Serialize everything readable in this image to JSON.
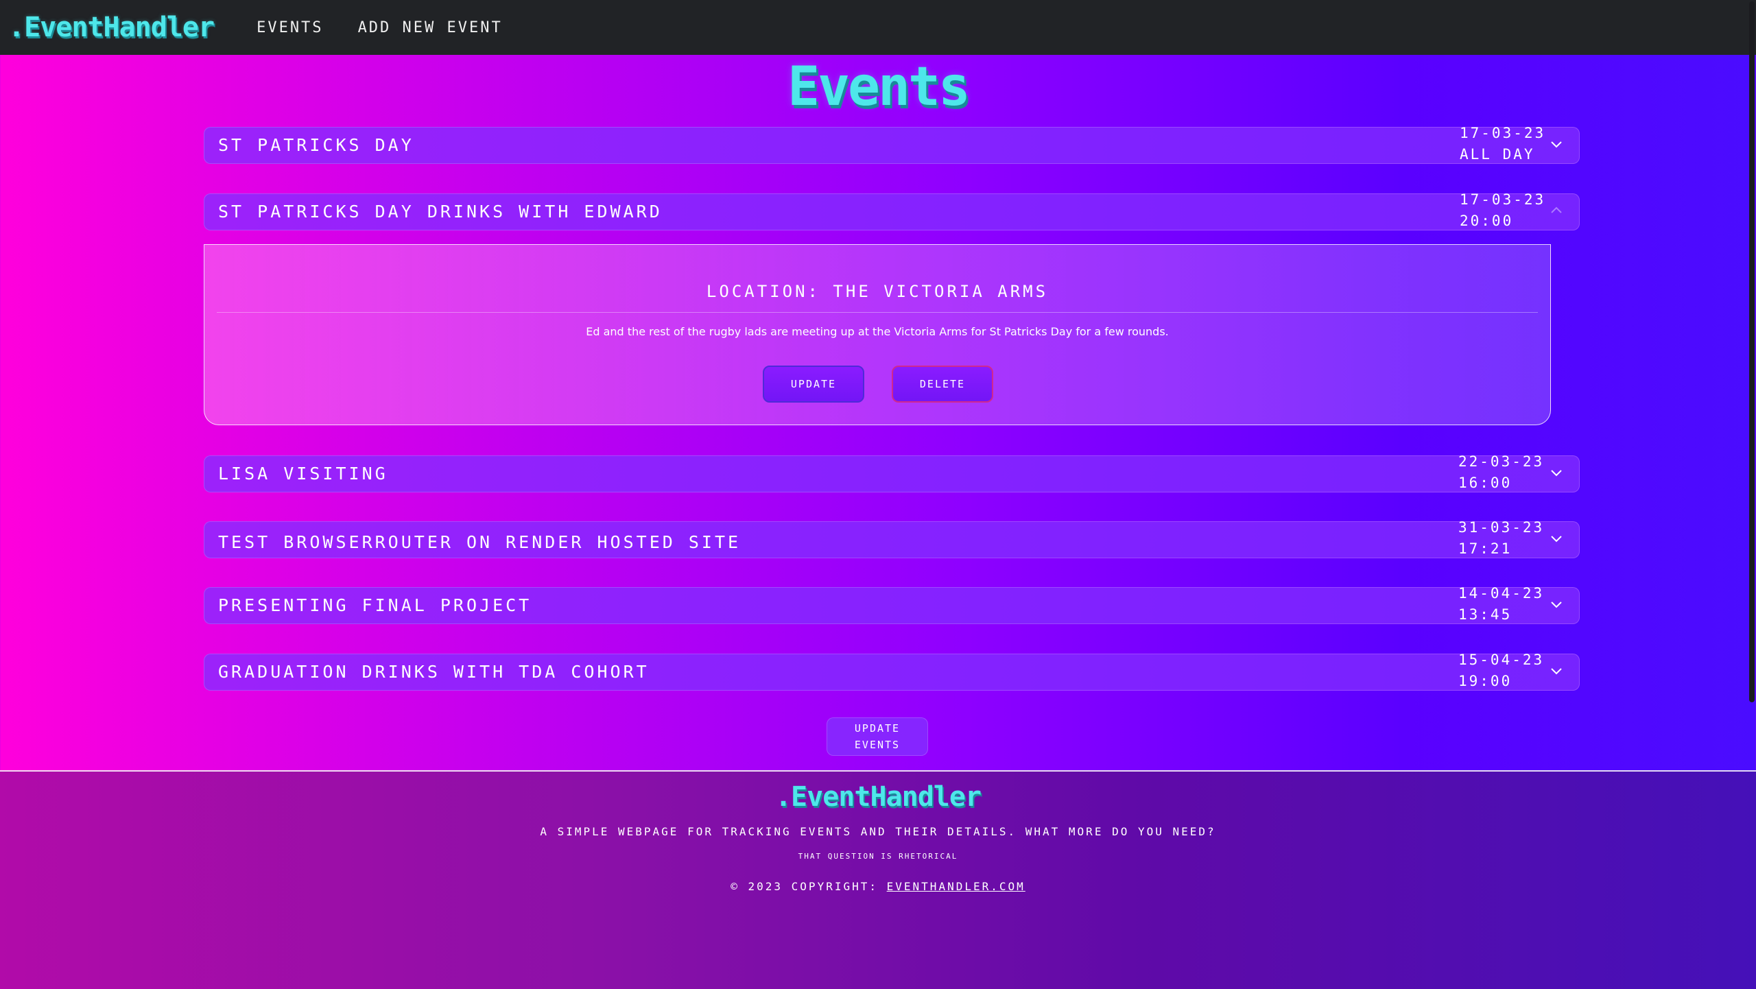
{
  "navbar": {
    "brand": ".EventHandler",
    "links": [
      "Events",
      "Add New Event"
    ]
  },
  "page": {
    "title": "Events"
  },
  "events": [
    {
      "title": "St Patricks Day",
      "date": "17-03-23",
      "time": "All Day",
      "expanded": false
    },
    {
      "title": "St Patricks Day Drinks with Edward",
      "date": "17-03-23",
      "time": "20:00",
      "expanded": true
    },
    {
      "title": "Lisa Visiting",
      "date": "22-03-23",
      "time": "16:00",
      "expanded": false
    },
    {
      "title": "Test BrowserRouter on Render Hosted Site",
      "date": "31-03-23",
      "time": "17:21",
      "expanded": false
    },
    {
      "title": "Presenting Final Project",
      "date": "14-04-23",
      "time": "13:45",
      "expanded": false
    },
    {
      "title": "Graduation Drinks with TDA Cohort",
      "date": "15-04-23",
      "time": "19:00",
      "expanded": false
    }
  ],
  "details": {
    "location": "Location: The Victoria Arms",
    "description": "Ed and the rest of the rugby lads are meeting up at the Victoria Arms for St Patricks Day for a few rounds.",
    "update_label": "Update",
    "delete_label": "Delete"
  },
  "update_events": {
    "line1": "Update",
    "line2": "Events"
  },
  "footer": {
    "brand": ".EventHandler",
    "tagline": "A simple webpage for tracking events and their details. What more do you need?",
    "note": "That question is rhetorical",
    "copyright_prefix": "© 2023 Copyright:",
    "link": "EventHandler.com"
  },
  "icons": {
    "accordion_toggle": "chevron-down-icon",
    "accordion_toggle_expanded": "chevron-up-icon"
  },
  "colors": {
    "brand": "#4ee7ea",
    "navbar_bg": "#212326",
    "row_bg": "#8a2bff",
    "delete_border": "#d0288f"
  }
}
